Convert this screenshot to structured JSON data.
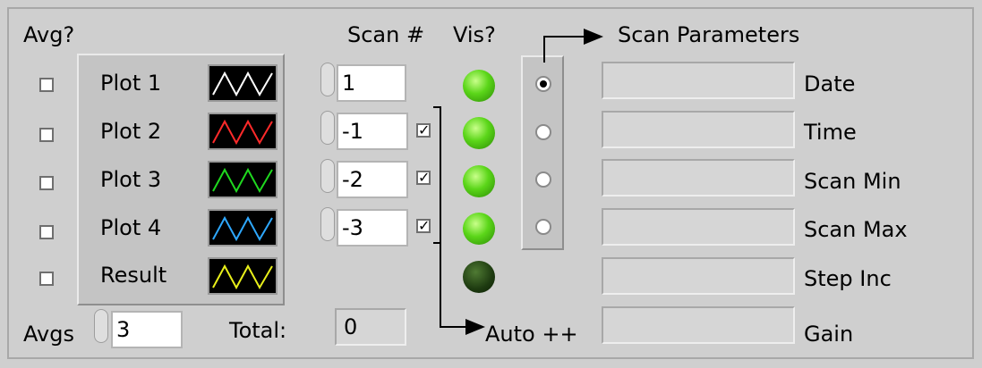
{
  "labels": {
    "avg": "Avg?",
    "scan_num": "Scan #",
    "vis": "Vis?",
    "scan_parameters": "Scan Parameters",
    "avgs": "Avgs",
    "total": "Total:",
    "auto": "Auto ++"
  },
  "plots": [
    {
      "label": "Plot 1",
      "color": "#ffffff"
    },
    {
      "label": "Plot 2",
      "color": "#ff2a2a"
    },
    {
      "label": "Plot 3",
      "color": "#1fd81f"
    },
    {
      "label": "Plot 4",
      "color": "#2ea8ff"
    },
    {
      "label": "Result",
      "color": "#e9f01a"
    }
  ],
  "avg_checkboxes": [
    false,
    false,
    false,
    false,
    false
  ],
  "scans": [
    {
      "value": "1"
    },
    {
      "value": "-1",
      "checked": true
    },
    {
      "value": "-2",
      "checked": true
    },
    {
      "value": "-3",
      "checked": true
    }
  ],
  "vis_leds": [
    "on",
    "on",
    "on",
    "on",
    "off"
  ],
  "radio_selected": 0,
  "parameters": [
    {
      "label": "Date",
      "value": ""
    },
    {
      "label": "Time",
      "value": ""
    },
    {
      "label": "Scan Min",
      "value": ""
    },
    {
      "label": "Scan Max",
      "value": ""
    },
    {
      "label": "Step Inc",
      "value": ""
    },
    {
      "label": "Gain",
      "value": ""
    }
  ],
  "avgs_value": "3",
  "total_value": "0"
}
